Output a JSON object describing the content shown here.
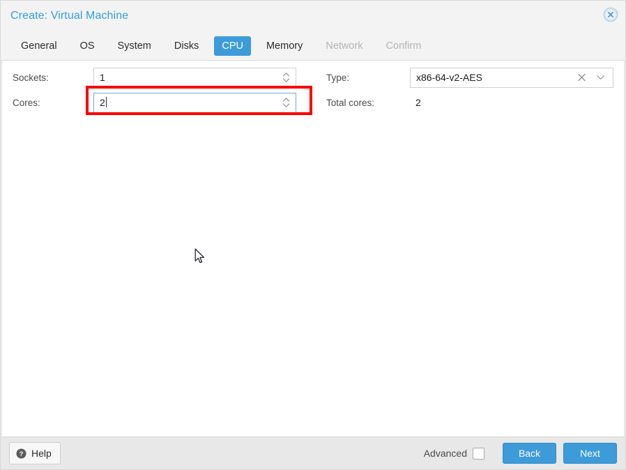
{
  "window": {
    "title": "Create: Virtual Machine",
    "close_icon": "close-circle-icon"
  },
  "tabs": [
    {
      "label": "General",
      "state": "normal"
    },
    {
      "label": "OS",
      "state": "normal"
    },
    {
      "label": "System",
      "state": "normal"
    },
    {
      "label": "Disks",
      "state": "normal"
    },
    {
      "label": "CPU",
      "state": "active"
    },
    {
      "label": "Memory",
      "state": "normal"
    },
    {
      "label": "Network",
      "state": "disabled"
    },
    {
      "label": "Confirm",
      "state": "disabled"
    }
  ],
  "form": {
    "sockets": {
      "label": "Sockets:",
      "value": "1"
    },
    "cores": {
      "label": "Cores:",
      "value": "2",
      "focused": true,
      "highlighted": true
    },
    "type": {
      "label": "Type:",
      "value": "x86-64-v2-AES",
      "clear_icon": "close-x-icon",
      "chevron_icon": "chevron-down-icon"
    },
    "total_cores": {
      "label": "Total cores:",
      "value": "2"
    }
  },
  "footer": {
    "help_label": "Help",
    "help_icon": "question-circle-icon",
    "advanced_label": "Advanced",
    "advanced_checked": false,
    "back_label": "Back",
    "next_label": "Next"
  },
  "colors": {
    "accent": "#3c9bd8",
    "title": "#2f9fd8",
    "highlight": "#fb0000",
    "footer_bg": "#e8e8e8",
    "titlebar_bg": "#f3f3f3"
  }
}
